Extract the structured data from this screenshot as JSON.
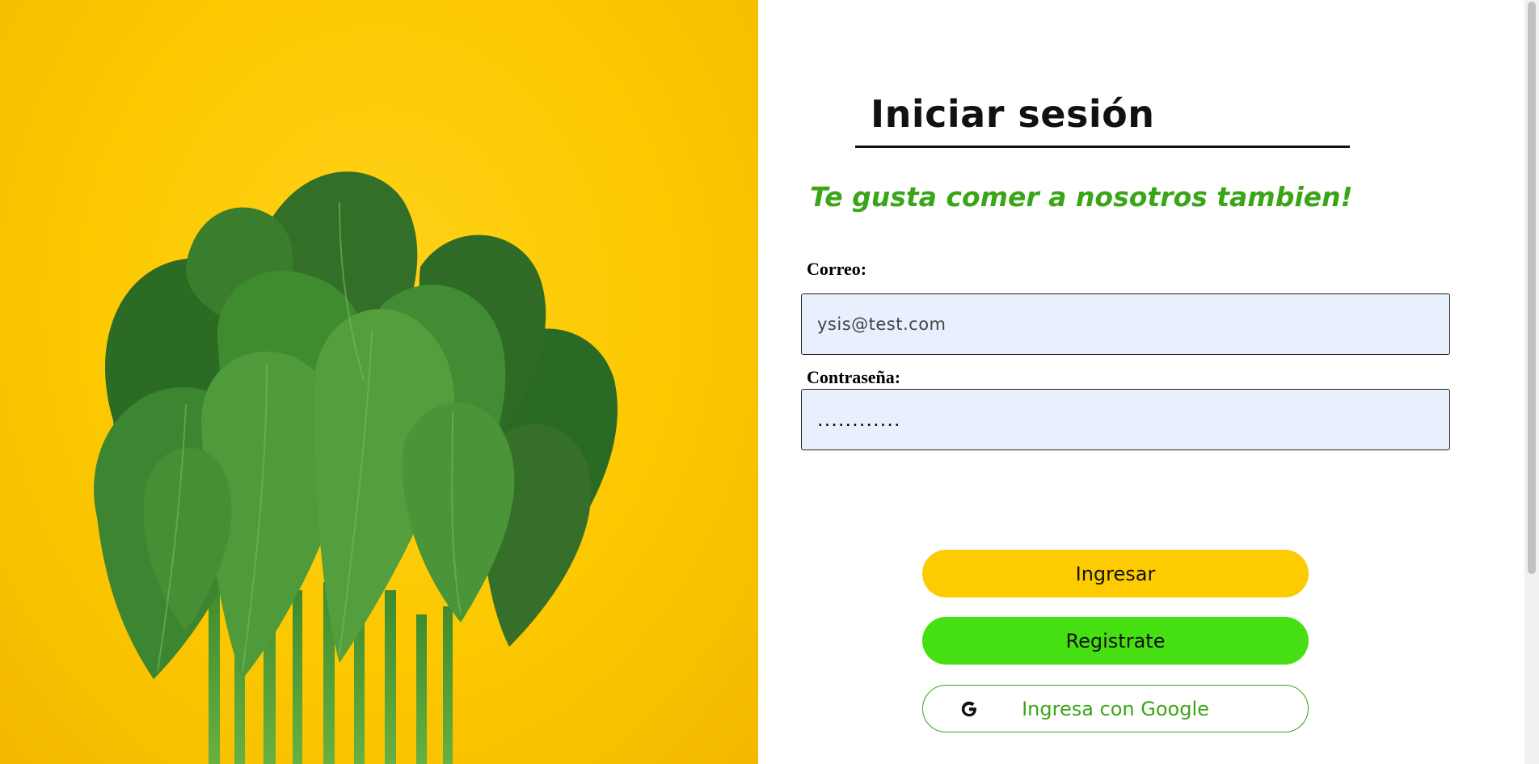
{
  "login": {
    "title": "Iniciar sesión",
    "tagline": "Te gusta comer a nosotros tambien!",
    "email_label": "Correo:",
    "email_value": "ysis@test.com",
    "password_label": "Contraseña:",
    "password_value": "............",
    "login_button": "Ingresar",
    "register_button": "Registrate",
    "google_button": "Ingresa con Google"
  },
  "hero": {
    "image": "spinach-bunch-on-yellow",
    "background_color": "#fcc800"
  },
  "colors": {
    "accent_green": "#3aa516",
    "register_green": "#46e012",
    "login_yellow": "#fccb00",
    "input_bg": "#e8f0fe"
  },
  "icons": {
    "google": "google-g-icon"
  }
}
